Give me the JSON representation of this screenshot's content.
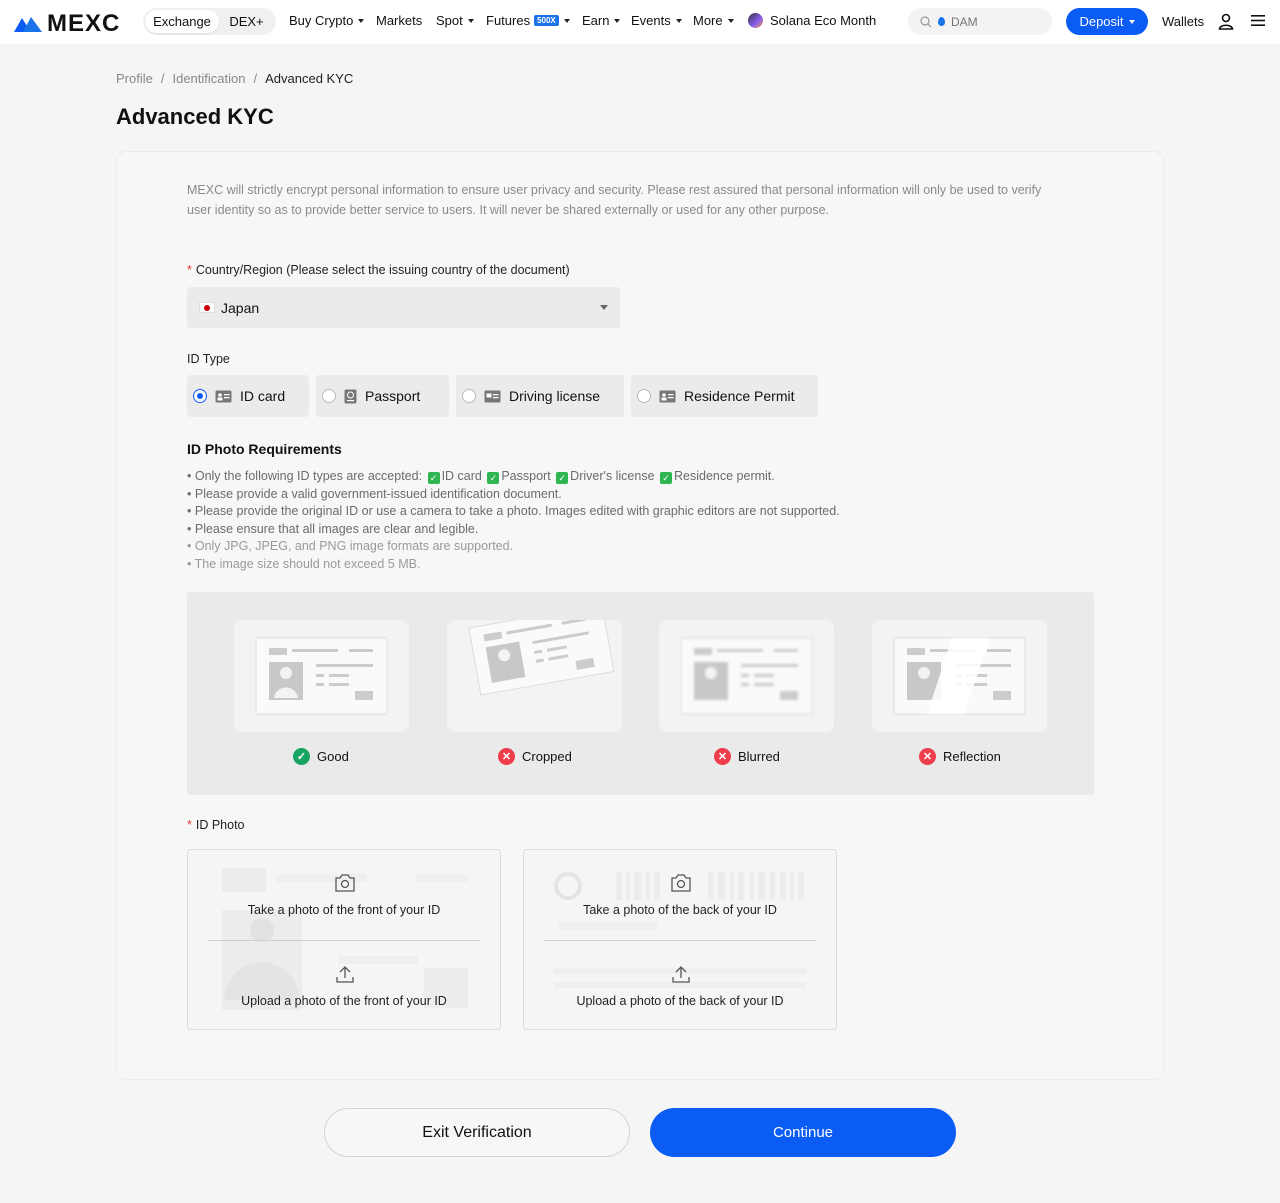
{
  "nav": {
    "logo": "MEXC",
    "segments": [
      "Exchange",
      "DEX+"
    ],
    "menus": [
      "Buy Crypto",
      "Markets",
      "Spot",
      "Futures",
      "Earn",
      "Events",
      "More"
    ],
    "futures_badge": "500X",
    "promo": "Solana Eco Month",
    "search_placeholder": "DAM",
    "deposit": "Deposit",
    "wallets": "Wallets",
    "accent": "#0a5cf5"
  },
  "breadcrumb": [
    "Profile",
    "Identification",
    "Advanced KYC"
  ],
  "page_title": "Advanced KYC",
  "notice": "MEXC will strictly encrypt personal information to ensure user privacy and security. Please rest assured that personal information will only be used to verify user identity so as to provide better service to users. It will never be shared externally or used for any other purpose.",
  "country": {
    "label": "Country/Region (Please select the issuing country of the document)",
    "value": "Japan"
  },
  "id_type": {
    "label": "ID Type",
    "options": [
      "ID card",
      "Passport",
      "Driving license",
      "Residence Permit"
    ],
    "selected": "ID card"
  },
  "requirements": {
    "title": "ID Photo Requirements",
    "accepted_prefix": "Only the following ID types are accepted:",
    "accepted": [
      "ID card",
      "Passport",
      "Driver's license",
      "Residence permit."
    ],
    "items": [
      "Please provide a valid government-issued identification document.",
      "Please provide the original ID or use a camera to take a photo. Images edited with graphic editors are not supported.",
      "Please ensure that all images are clear and legible.",
      "Only JPG, JPEG, and PNG image formats are supported.",
      "The image size should not exceed 5 MB."
    ]
  },
  "examples": [
    "Good",
    "Cropped",
    "Blurred",
    "Reflection"
  ],
  "id_photo": {
    "label": "ID Photo",
    "front_take": "Take a photo of the front of your ID",
    "front_upload": "Upload a photo of the front of your ID",
    "back_take": "Take a photo of the back of your ID",
    "back_upload": "Upload a photo of the back of your ID"
  },
  "buttons": {
    "exit": "Exit Verification",
    "continue": "Continue"
  }
}
